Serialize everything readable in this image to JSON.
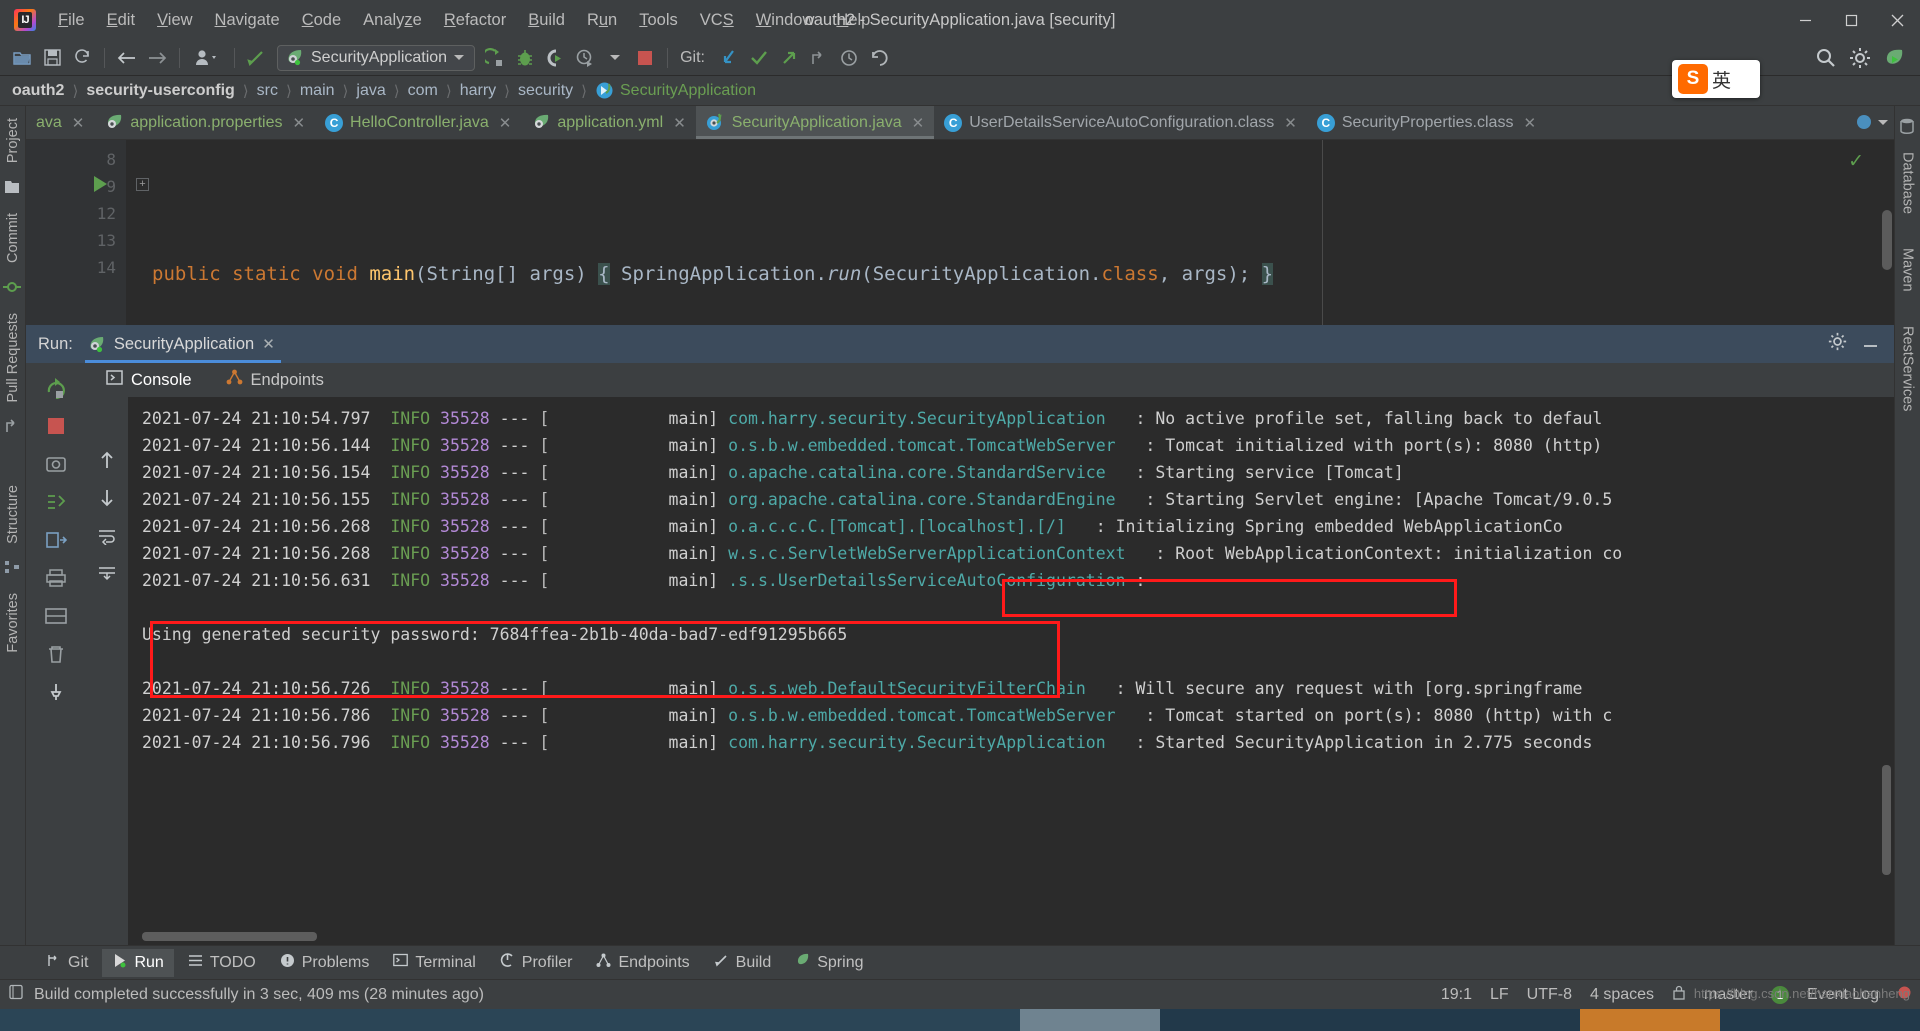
{
  "window": {
    "title": "oauth2 - SecurityApplication.java [security]",
    "controls": [
      "minimize",
      "maximize",
      "close"
    ]
  },
  "menu": [
    {
      "label": "File",
      "mnemonic": "F"
    },
    {
      "label": "Edit",
      "mnemonic": "E"
    },
    {
      "label": "View",
      "mnemonic": "V"
    },
    {
      "label": "Navigate",
      "mnemonic": "N"
    },
    {
      "label": "Code",
      "mnemonic": "C"
    },
    {
      "label": "Analyze",
      "mnemonic": "z"
    },
    {
      "label": "Refactor",
      "mnemonic": "R"
    },
    {
      "label": "Build",
      "mnemonic": "B"
    },
    {
      "label": "Run",
      "mnemonic": "u"
    },
    {
      "label": "Tools",
      "mnemonic": "T"
    },
    {
      "label": "VCS",
      "mnemonic": "S"
    },
    {
      "label": "Window",
      "mnemonic": "W"
    },
    {
      "label": "Help",
      "mnemonic": "H"
    }
  ],
  "toolbar": {
    "open_icon": "open-folder-icon",
    "save_icon": "save-icon",
    "sync_icon": "sync-icon",
    "back_icon": "back-arrow-icon",
    "forward_icon": "forward-arrow-icon",
    "profile_icon": "user-profile-icon",
    "build_icon": "build-hammer-icon",
    "run_config_name": "SecurityApplication",
    "run_icon": "run-icon",
    "debug_icon": "debug-bug-icon",
    "run_coverage_icon": "run-with-coverage-icon",
    "profile_run_icon": "profile-run-icon",
    "stop_icon": "stop-icon",
    "git_label": "Git:",
    "git_update_icon": "git-update-icon",
    "git_commit_icon": "git-commit-check-icon",
    "git_push_icon": "git-push-icon",
    "git_branch_icon": "git-branch-icon",
    "history_icon": "history-clock-icon",
    "rollback_icon": "rollback-icon",
    "search_icon": "search-everywhere-icon",
    "settings_icon": "gear-icon",
    "spring_run_icon": "spring-run-icon"
  },
  "breadcrumb": [
    {
      "label": "oauth2",
      "style": "bold"
    },
    {
      "label": "security-userconfig",
      "style": "bold"
    },
    {
      "label": "src",
      "style": "normal"
    },
    {
      "label": "main",
      "style": "normal"
    },
    {
      "label": "java",
      "style": "normal"
    },
    {
      "label": "com",
      "style": "normal"
    },
    {
      "label": "harry",
      "style": "normal"
    },
    {
      "label": "security",
      "style": "normal"
    },
    {
      "label": "SecurityApplication",
      "style": "file"
    }
  ],
  "editor_tabs": [
    {
      "label": "ava",
      "icon": "java-file-icon",
      "active": false,
      "kind": "java",
      "truncated": true
    },
    {
      "label": "application.properties",
      "icon": "spring-properties-icon",
      "active": false,
      "kind": "spring"
    },
    {
      "label": "HelloController.java",
      "icon": "class-icon",
      "active": false,
      "kind": "class"
    },
    {
      "label": "application.yml",
      "icon": "spring-properties-icon",
      "active": false,
      "kind": "spring"
    },
    {
      "label": "SecurityApplication.java",
      "icon": "spring-boot-icon",
      "active": true,
      "kind": "spring"
    },
    {
      "label": "UserDetailsServiceAutoConfiguration.class",
      "icon": "class-decompiled-icon",
      "active": false,
      "kind": "classfile"
    },
    {
      "label": "SecurityProperties.class",
      "icon": "class-decompiled-icon",
      "active": false,
      "kind": "classfile"
    }
  ],
  "editor": {
    "line_numbers": [
      "8",
      "9",
      "12",
      "13",
      "14"
    ],
    "lines": [
      "",
      "    public static void main(String[] args) { SpringApplication.run(SecurityApplication.class, args); }",
      "",
      "}",
      ""
    ],
    "code_tokens": {
      "indent": "    ",
      "kw_public": "public",
      "kw_static": "static",
      "kw_void": "void",
      "method_name": "main",
      "params": "(String[] args)",
      "brace_open": "{",
      "body": "SpringApplication.",
      "run_call": "run",
      "arg1": "(SecurityApplication.",
      "kw_class": "class",
      "arg2": ", args);",
      "brace_close": "}",
      "closing_brace": "}"
    },
    "inspection_status": "ok-checkmark"
  },
  "run_panel": {
    "label": "Run:",
    "tab_name": "SecurityApplication",
    "tab_icon": "spring-run-icon",
    "close_icon": "close-icon",
    "settings_icon": "gear-icon",
    "minimize_icon": "minimize-icon",
    "console_tabs": [
      {
        "label": "Console",
        "icon": "console-icon",
        "active": true
      },
      {
        "label": "Endpoints",
        "icon": "endpoints-icon",
        "active": false
      }
    ],
    "side_actions": [
      "rerun-icon",
      "stop-icon",
      "camera-icon",
      "thread-dump-icon",
      "export-icon",
      "print-icon",
      "layout-icon",
      "trash-icon",
      "pin-icon"
    ],
    "scroll_actions": [
      "scroll-up-icon",
      "scroll-down-icon",
      "soft-wrap-icon",
      "scroll-to-end-icon"
    ]
  },
  "console_log": {
    "lines": [
      {
        "time": "2021-07-24 21:10:54.797",
        "level": "INFO",
        "pid": "35528",
        "sep": "---",
        "thread": "main]",
        "logger": "com.harry.security.SecurityApplication",
        "message": ": No active profile set, falling back to defaul"
      },
      {
        "time": "2021-07-24 21:10:56.144",
        "level": "INFO",
        "pid": "35528",
        "sep": "---",
        "thread": "main]",
        "logger": "o.s.b.w.embedded.tomcat.TomcatWebServer",
        "message": ": Tomcat initialized with port(s): 8080 (http)"
      },
      {
        "time": "2021-07-24 21:10:56.154",
        "level": "INFO",
        "pid": "35528",
        "sep": "---",
        "thread": "main]",
        "logger": "o.apache.catalina.core.StandardService",
        "message": ": Starting service [Tomcat]"
      },
      {
        "time": "2021-07-24 21:10:56.155",
        "level": "INFO",
        "pid": "35528",
        "sep": "---",
        "thread": "main]",
        "logger": "org.apache.catalina.core.StandardEngine",
        "message": ": Starting Servlet engine: [Apache Tomcat/9.0.5"
      },
      {
        "time": "2021-07-24 21:10:56.268",
        "level": "INFO",
        "pid": "35528",
        "sep": "---",
        "thread": "main]",
        "logger": "o.a.c.c.C.[Tomcat].[localhost].[/]",
        "message": ": Initializing Spring embedded WebApplicationCo"
      },
      {
        "time": "2021-07-24 21:10:56.268",
        "level": "INFO",
        "pid": "35528",
        "sep": "---",
        "thread": "main]",
        "logger": "w.s.c.ServletWebServerApplicationContext",
        "message": ": Root WebApplicationContext: initialization co"
      },
      {
        "time": "2021-07-24 21:10:56.631",
        "level": "INFO",
        "pid": "35528",
        "sep": "---",
        "thread": "main]",
        "logger": ".s.s.UserDetailsServiceAutoConfiguration",
        "message": ":"
      }
    ],
    "password_line": "Using generated security password: 7684ffea-2b1b-40da-bad7-edf91295b665",
    "lines_after": [
      {
        "time": "2021-07-24 21:10:56.726",
        "level": "INFO",
        "pid": "35528",
        "sep": "---",
        "thread": "main]",
        "logger": "o.s.s.web.DefaultSecurityFilterChain",
        "message": ": Will secure any request with [org.springframe"
      },
      {
        "time": "2021-07-24 21:10:56.786",
        "level": "INFO",
        "pid": "35528",
        "sep": "---",
        "thread": "main]",
        "logger": "o.s.b.w.embedded.tomcat.TomcatWebServer",
        "message": ": Tomcat started on port(s): 8080 (http) with c"
      },
      {
        "time": "2021-07-24 21:10:56.796",
        "level": "INFO",
        "pid": "35528",
        "sep": "---",
        "thread": "main]",
        "logger": "com.harry.security.SecurityApplication",
        "message": ": Started SecurityApplication in 2.775 seconds"
      }
    ],
    "highlight_color": "#ff1a1a"
  },
  "left_strip": [
    {
      "label": "Project",
      "icon": "project-icon"
    },
    {
      "label": "Commit",
      "icon": "commit-icon"
    },
    {
      "label": "Pull Requests",
      "icon": "pull-request-icon"
    },
    {
      "label": "Structure",
      "icon": "structure-icon"
    },
    {
      "label": "Favorites",
      "icon": "favorites-icon"
    }
  ],
  "right_strip": [
    {
      "label": "Database",
      "icon": "database-icon"
    },
    {
      "label": "Maven",
      "icon": "maven-icon"
    },
    {
      "label": "RestServices",
      "icon": "rest-services-icon"
    }
  ],
  "bottom_bar": [
    {
      "label": "Git",
      "icon": "git-icon",
      "active": false
    },
    {
      "label": "Run",
      "icon": "run-icon",
      "active": true
    },
    {
      "label": "TODO",
      "icon": "todo-icon",
      "active": false
    },
    {
      "label": "Problems",
      "icon": "problems-icon",
      "active": false
    },
    {
      "label": "Terminal",
      "icon": "terminal-icon",
      "active": false
    },
    {
      "label": "Profiler",
      "icon": "profiler-icon",
      "active": false
    },
    {
      "label": "Endpoints",
      "icon": "endpoints-icon",
      "active": false
    },
    {
      "label": "Build",
      "icon": "build-icon",
      "active": false
    },
    {
      "label": "Spring",
      "icon": "spring-icon",
      "active": false
    }
  ],
  "status_bar": {
    "message_icon": "message-icon",
    "message": "Build completed successfully in 3 sec, 409 ms (28 minutes ago)",
    "caret": "19:1",
    "line_separator": "LF",
    "encoding": "UTF-8",
    "indent": "4 spaces",
    "branch": "master",
    "event_log": "Event Log",
    "event_count": "1",
    "lock_icon": "lock-icon",
    "notification_icon": "notification-icon"
  },
  "ime_widget": {
    "logo_text": "S",
    "mode": "英"
  },
  "watermark": "https://blog.csdn.net/hanxiaohanheng"
}
